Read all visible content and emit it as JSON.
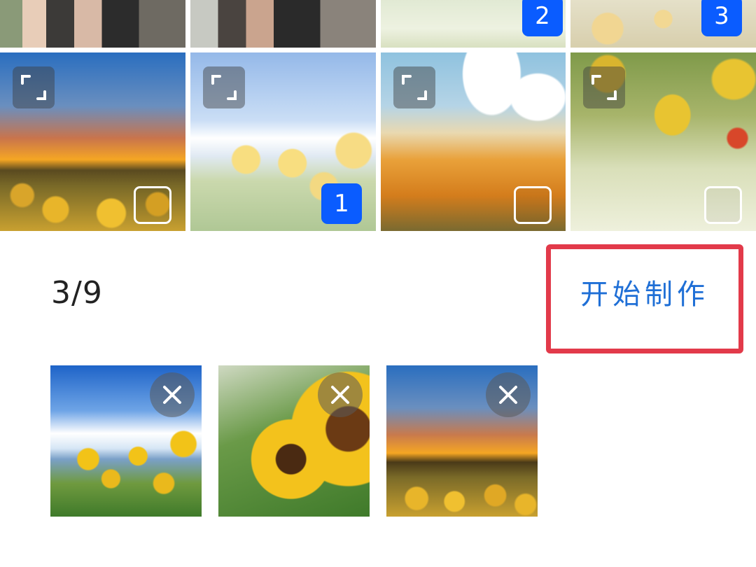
{
  "grid": {
    "cells": [
      {
        "name": "photo-people-1",
        "kind": "people"
      },
      {
        "name": "photo-people-2",
        "kind": "people"
      },
      {
        "name": "photo-top-3",
        "kind": "meadow",
        "selection": "2"
      },
      {
        "name": "photo-top-4",
        "kind": "sunflowers",
        "selection": "3"
      },
      {
        "name": "photo-sunset-field",
        "kind": "sunset"
      },
      {
        "name": "photo-sunflower-sky",
        "kind": "sky",
        "selection": "1"
      },
      {
        "name": "photo-orange-flowers",
        "kind": "orange"
      },
      {
        "name": "photo-yellow-tulips",
        "kind": "tulip"
      }
    ]
  },
  "selection": {
    "count_text": "3/9",
    "start_button": "开始制作"
  },
  "selected_thumbs": [
    {
      "name": "selected-sunflower-sky"
    },
    {
      "name": "selected-sunflower-closeup"
    },
    {
      "name": "selected-sunset-field"
    }
  ],
  "colors": {
    "accent": "#0a5cff",
    "start_text": "#1f6fd6",
    "highlight_border": "#e23a4a"
  },
  "icons": {
    "expand": "expand-icon",
    "remove": "close-icon"
  }
}
